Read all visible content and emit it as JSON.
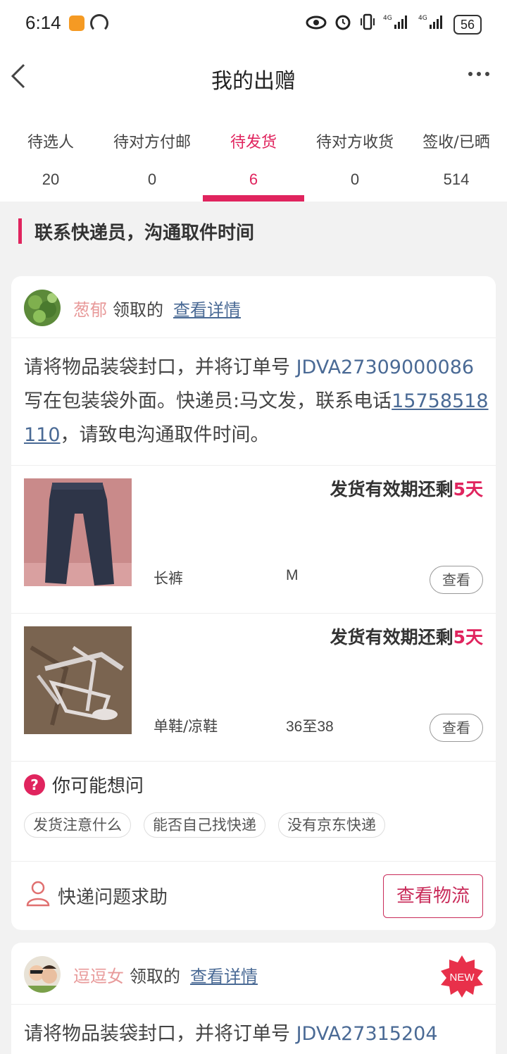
{
  "status_bar": {
    "time": "6:14",
    "battery": "56",
    "icons": [
      "eye-icon",
      "alarm-icon",
      "vibrate-icon",
      "signal-4g-icon",
      "signal-4g-icon"
    ]
  },
  "nav": {
    "title": "我的出赠",
    "back_icon": "chevron-left-icon",
    "more_icon": "more-dots-icon"
  },
  "tabs": [
    {
      "label": "待选人",
      "count": "20"
    },
    {
      "label": "待对方付邮",
      "count": "0"
    },
    {
      "label": "待发货",
      "count": "6",
      "active": true
    },
    {
      "label": "待对方收货",
      "count": "0"
    },
    {
      "label": "签收/已晒",
      "count": "514"
    }
  ],
  "section_title": "联系快递员，沟通取件时间",
  "orders": [
    {
      "claimer": "葱郁",
      "claimed_label": "领取的",
      "detail_link": "查看详情",
      "instruction_prefix": "请将物品装袋封口，并将订单号 ",
      "order_number": "JDVA27309000086",
      "instruction_mid": " 写在包装袋外面。快递员:马文发，联系电话",
      "phone": "15758518110",
      "instruction_suffix": "，请致电沟通取件时间。",
      "items": [
        {
          "deadline_prefix": "发货有效期还剩",
          "deadline_value": "5天",
          "category": "长裤",
          "size": "M",
          "view_label": "查看"
        },
        {
          "deadline_prefix": "发货有效期还剩",
          "deadline_value": "5天",
          "category": "单鞋/凉鞋",
          "size": "36至38",
          "view_label": "查看"
        }
      ],
      "faq": {
        "title": "你可能想问",
        "chips": [
          "发货注意什么",
          "能否自己找快递",
          "没有京东快递"
        ]
      },
      "help_label": "快递问题求助",
      "track_label": "查看物流"
    },
    {
      "claimer": "逗逗女",
      "claimed_label": "领取的",
      "detail_link": "查看详情",
      "badge": "NEW",
      "instruction_prefix": "请将物品装袋封口，并将订单号 ",
      "order_number": "JDVA27315204"
    }
  ],
  "colors": {
    "accent": "#e0245e",
    "link": "#4a6a95",
    "claimer_name": "#e89a9a",
    "background": "#f2f2f2"
  }
}
